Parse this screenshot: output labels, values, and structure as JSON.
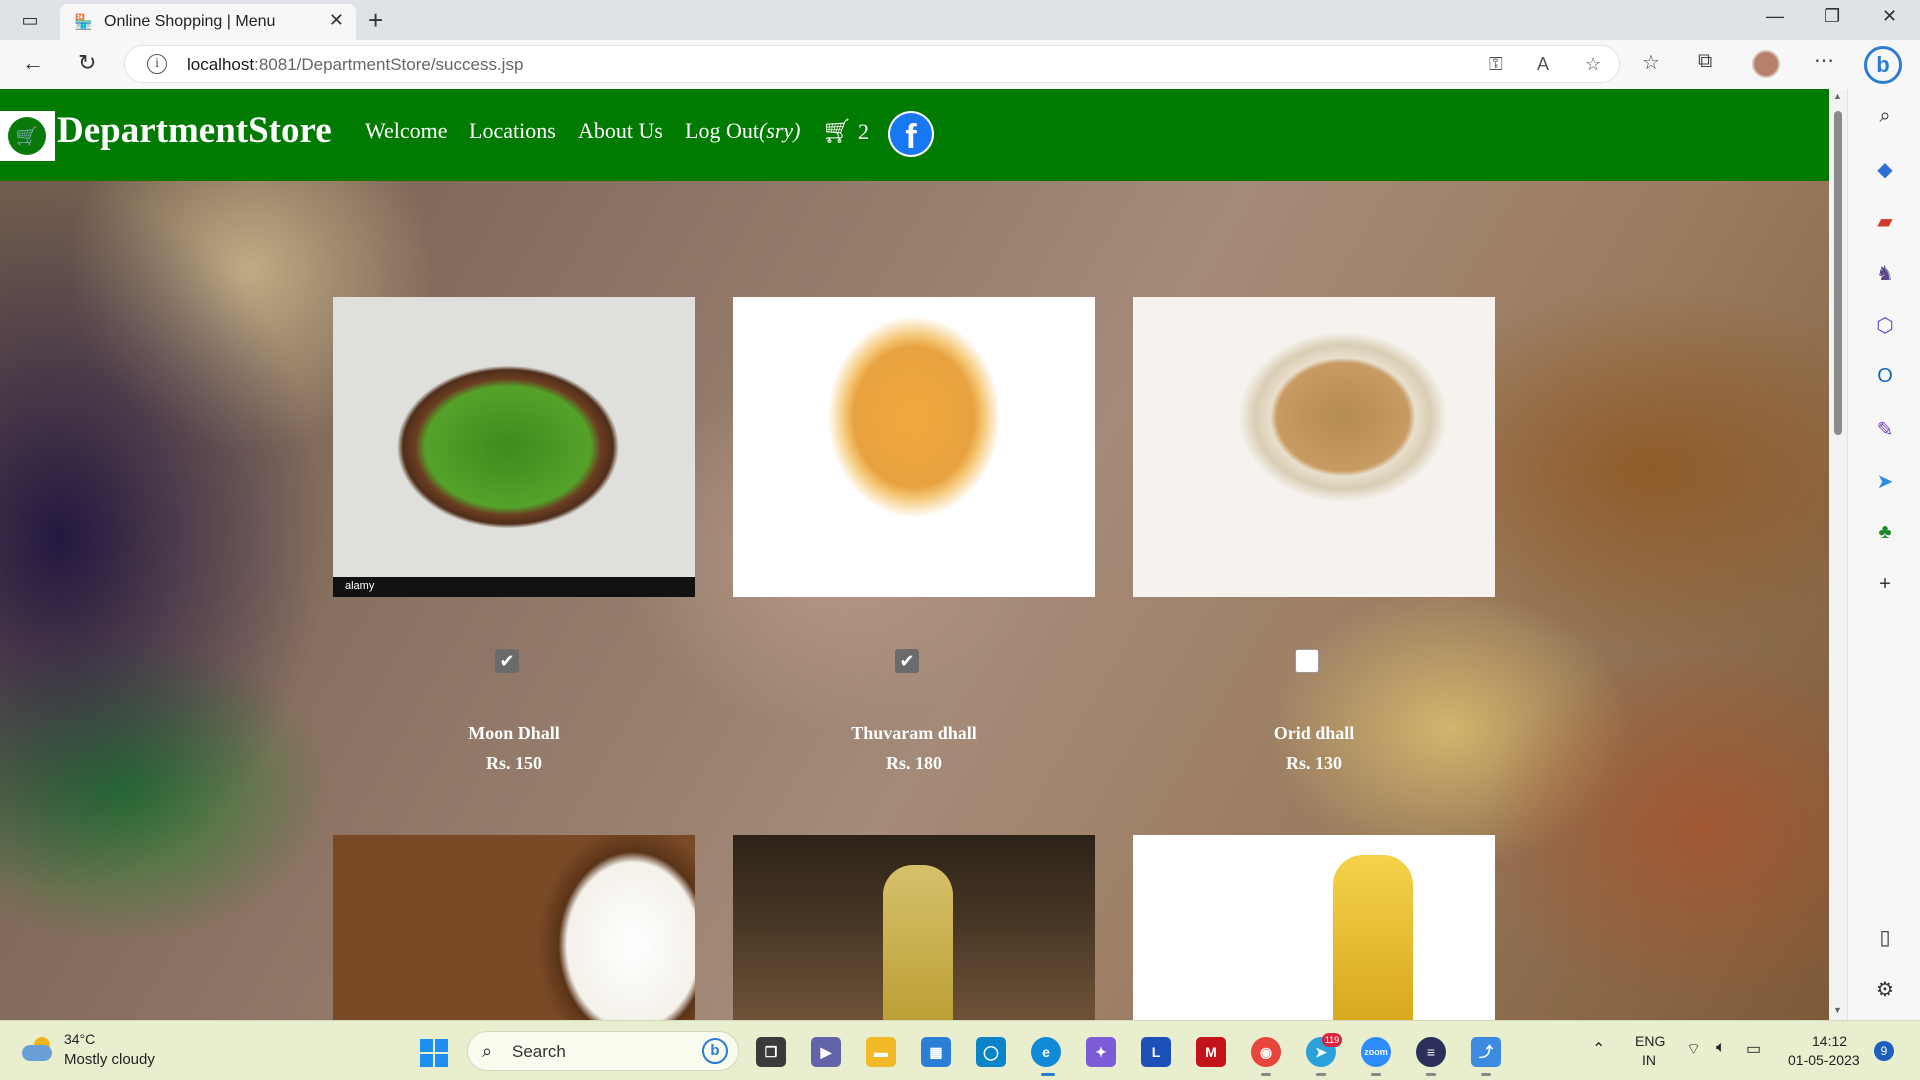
{
  "browser": {
    "tab_title": "Online Shopping | Menu",
    "url_host": "localhost",
    "url_path": ":8081/DepartmentStore/success.jsp"
  },
  "site": {
    "brand": "DepartmentStore",
    "nav": {
      "welcome": "Welcome",
      "locations": "Locations",
      "about": "About Us",
      "logout": "Log Out",
      "logout_suffix": "(sry)"
    },
    "cart_count": "2",
    "facebook_letter": "f"
  },
  "products": [
    {
      "name": "Moon Dhall",
      "price": "Rs. 150",
      "checked": true,
      "image": "moong-dal",
      "image_footer": "alamy"
    },
    {
      "name": "Thuvaram dhall",
      "price": "Rs. 180",
      "checked": true,
      "image": "toor-dal"
    },
    {
      "name": "Orid dhall",
      "price": "Rs. 130",
      "checked": false,
      "image": "urad-dal"
    },
    {
      "image": "coconut-oil"
    },
    {
      "image": "sunflower-oil"
    },
    {
      "image": "olive-oil"
    }
  ],
  "taskbar": {
    "temperature": "34°C",
    "weather": "Mostly cloudy",
    "search_label": "Search",
    "telegram_badge": "119",
    "lang_line1": "ENG",
    "lang_line2": "IN",
    "time": "14:12",
    "date": "01-05-2023",
    "notifications": "9"
  },
  "colors": {
    "nav_green": "#007a00",
    "checkbox_checked": "#6b6b6b"
  }
}
